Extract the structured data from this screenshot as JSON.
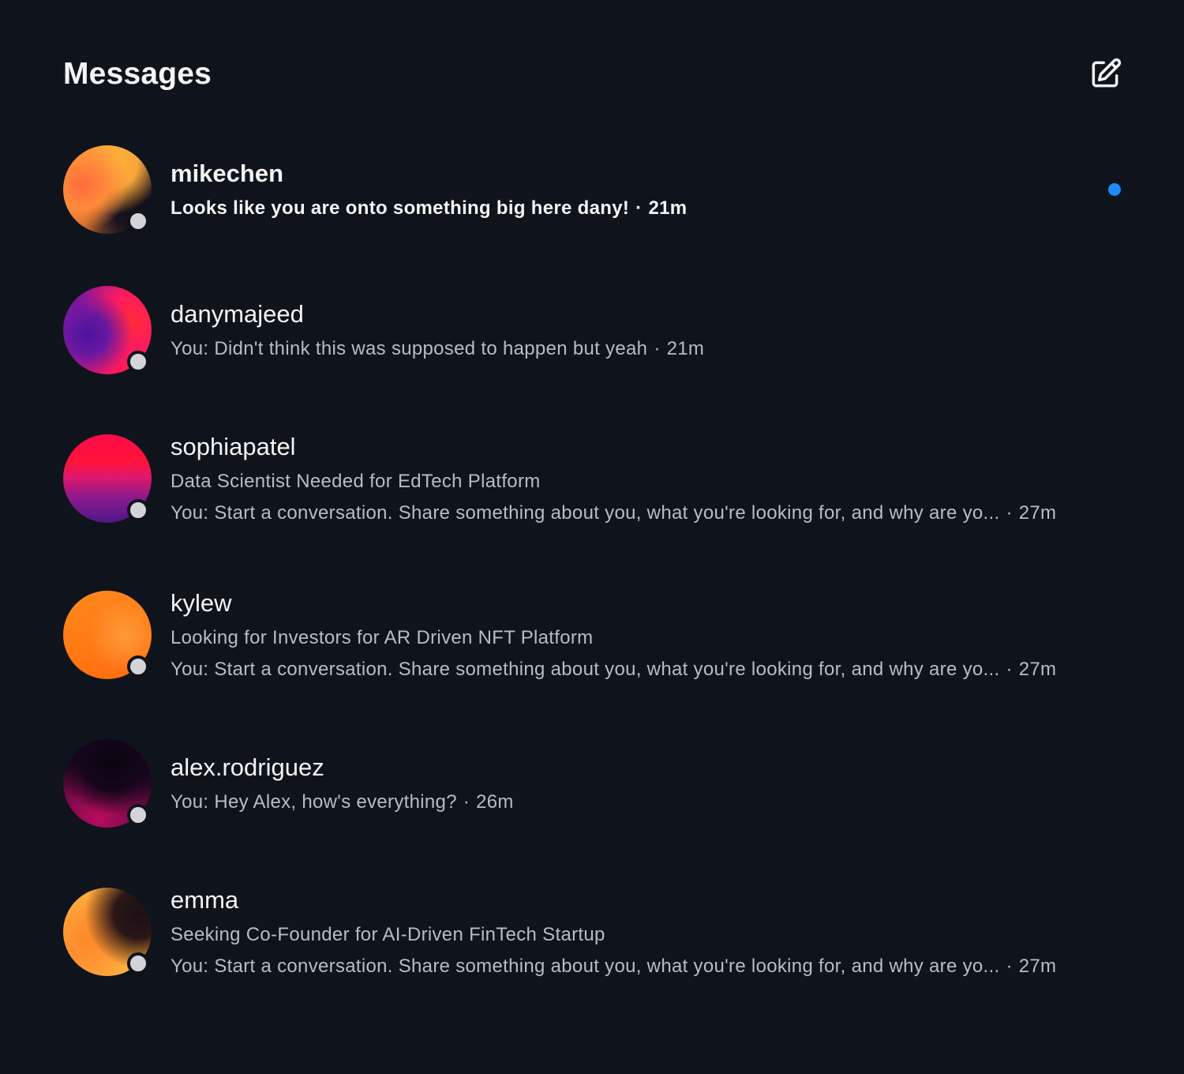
{
  "header": {
    "title": "Messages",
    "compose_icon": "compose-edit-icon"
  },
  "separator": "·",
  "conversations": [
    {
      "username": "mikechen",
      "subject": "",
      "preview": "Looks like you are onto something big here dany!",
      "time": "21m",
      "unread": true,
      "avatar_colors": [
        "#ff6a3d",
        "#ffb13b",
        "#1a1320"
      ]
    },
    {
      "username": "danymajeed",
      "subject": "",
      "preview": "You: Didn't think this was supposed to happen but yeah",
      "time": "21m",
      "unread": false,
      "avatar_colors": [
        "#5a14a8",
        "#ff1b5e",
        "#ff2a2a"
      ]
    },
    {
      "username": "sophiapatel",
      "subject": "Data Scientist Needed for EdTech Platform",
      "preview": "You: Start a conversation. Share something about you, what you're looking for, and why are yo...",
      "time": "27m",
      "unread": false,
      "avatar_colors": [
        "#ff1140",
        "#e0186c",
        "#5e1a8c"
      ]
    },
    {
      "username": "kylew",
      "subject": "Looking for Investors for AR Driven NFT Platform",
      "preview": "You: Start a conversation. Share something about you, what you're looking for, and why are yo...",
      "time": "27m",
      "unread": false,
      "avatar_colors": [
        "#ff7a14",
        "#ff9a2a",
        "#ff6a10"
      ]
    },
    {
      "username": "alex.rodriguez",
      "subject": "",
      "preview": "You: Hey Alex, how's everything?",
      "time": "26m",
      "unread": false,
      "avatar_colors": [
        "#12060f",
        "#2a0620",
        "#a10a55"
      ]
    },
    {
      "username": "emma",
      "subject": "Seeking Co-Founder for AI-Driven FinTech Startup",
      "preview": "You: Start a conversation. Share something about you, what you're looking for, and why are yo...",
      "time": "27m",
      "unread": false,
      "avatar_colors": [
        "#ff8a2a",
        "#ffb640",
        "#1b1018"
      ]
    }
  ],
  "colors": {
    "background": "#0f131b",
    "unread_indicator": "#1d8cf8",
    "status_dot": "#d4d4d8"
  }
}
